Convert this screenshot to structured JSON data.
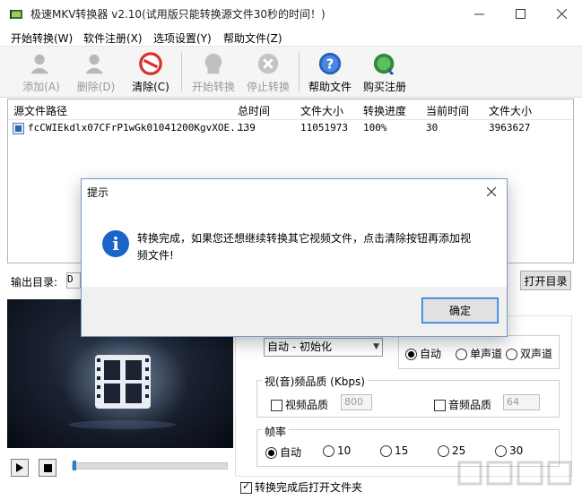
{
  "window": {
    "title": "极速MKV转换器 v2.10(试用版只能转换源文件30秒的时间！)",
    "icon": "app-logo-icon",
    "controls": [
      "minimize-icon",
      "maximize-icon",
      "close-icon"
    ]
  },
  "menu": {
    "items": [
      "开始转换(W)",
      "软件注册(X)",
      "选项设置(Y)",
      "帮助文件(Z)"
    ]
  },
  "toolbar": {
    "buttons": [
      {
        "label": "添加(A)",
        "icon": "add-person-icon",
        "enabled": false
      },
      {
        "label": "删除(D)",
        "icon": "delete-person-icon",
        "enabled": false
      },
      {
        "label": "清除(C)",
        "icon": "clear-forbidden-icon",
        "enabled": true
      },
      {
        "label": "开始转换",
        "icon": "start-convert-icon",
        "enabled": false
      },
      {
        "label": "停止转换",
        "icon": "stop-convert-icon",
        "enabled": false
      },
      {
        "label": "帮助文件",
        "icon": "help-icon",
        "enabled": true
      },
      {
        "label": "购买注册",
        "icon": "buy-register-icon",
        "enabled": true
      }
    ]
  },
  "table": {
    "columns": [
      "源文件路径",
      "总时间",
      "文件大小",
      "转换进度",
      "当前时间",
      "文件大小"
    ],
    "rows": [
      [
        "fcCWIEkdlx07CFrP1wGk01041200KgvXOE...",
        "139",
        "11051973",
        "100%",
        "30",
        "3963627"
      ]
    ]
  },
  "output": {
    "label": "输出目录:",
    "value": "D",
    "open_button": "打开目录"
  },
  "player": {
    "play_icon": "play-icon",
    "stop_icon": "stop-icon",
    "progress": 0.0
  },
  "settings": {
    "format_value": "自动 - 初始化",
    "channel_options": [
      "自动",
      "单声道",
      "双声道"
    ],
    "channel_selected": "自动",
    "quality_title": "视(音)频品质 (Kbps)",
    "video_quality_label": "视频品质",
    "video_quality_value": "800",
    "audio_quality_label": "音频品质",
    "audio_quality_value": "64",
    "framerate_title": "帧率",
    "framerate_options": [
      "自动",
      "10",
      "15",
      "25",
      "30"
    ],
    "framerate_selected": "自动",
    "open_after_label": "转换完成后打开文件夹",
    "open_after_checked": true
  },
  "dialog": {
    "title": "提示",
    "message": "转换完成，如果您还想继续转换其它视频文件，点击清除按钮再添加视频文件!",
    "ok_label": "确定",
    "icon": "info-icon"
  },
  "colors": {
    "accent": "#1c64c8",
    "dialog_border": "#7a9bc4",
    "clear_icon_red": "#d9312b"
  }
}
